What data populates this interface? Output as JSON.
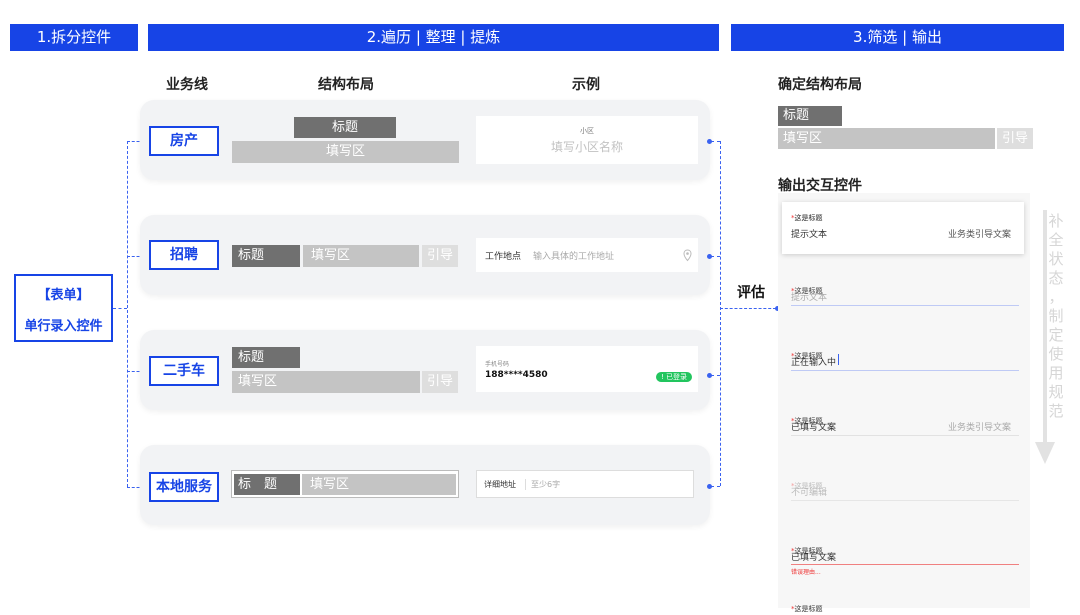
{
  "headers": {
    "step1": "1.拆分控件",
    "step2": "2.遍历 | 整理 | 提炼",
    "step3": "3.筛选 | 输出"
  },
  "columns": {
    "business": "业务线",
    "layout": "结构布局",
    "example": "示例"
  },
  "form": {
    "title": "【表单】",
    "subtitle": "单行录入控件"
  },
  "rows": {
    "house": {
      "name": "房产",
      "title": "标题",
      "fill": "填写区",
      "ex_label": "小区",
      "ex_placeholder": "填写小区名称"
    },
    "jobs": {
      "name": "招聘",
      "title": "标题",
      "fill": "填写区",
      "guide": "引导",
      "ex_label": "工作地点",
      "ex_placeholder": "输入具体的工作地址"
    },
    "car": {
      "name": "二手车",
      "title": "标题",
      "fill": "填写区",
      "guide": "引导",
      "ex_label": "手机号码",
      "ex_value": "188****4580",
      "ex_badge": "! 已登录"
    },
    "local": {
      "name": "本地服务",
      "title": "标　题",
      "fill": "填写区",
      "ex_label": "详细地址",
      "ex_placeholder": "至少6字"
    }
  },
  "evaluate": "评估",
  "right": {
    "confirm_title": "确定结构布局",
    "layout_title": "标题",
    "layout_fill": "填写区",
    "layout_guide": "引导",
    "output_title": "输出交互控件",
    "side_text": [
      "补",
      "全",
      "状",
      "态",
      "，",
      "制",
      "定",
      "使",
      "用",
      "规",
      "范"
    ],
    "states": [
      {
        "label": "这是标题",
        "value": "提示文本",
        "guide": "业务类引导文案"
      },
      {
        "label": "这是标题",
        "value": "提示文本"
      },
      {
        "label": "这是标题",
        "value": "正在输入中"
      },
      {
        "label": "这是标题",
        "value": "已填写文案",
        "guide": "业务类引导文案"
      },
      {
        "label": "这是标题",
        "value": "不可编辑"
      },
      {
        "label": "这是标题",
        "value": "已填写文案",
        "error": "错误理由..."
      },
      {
        "label": "这是标题"
      }
    ]
  },
  "colors": {
    "brand_blue": "#1744e6",
    "dark_gray": "#707070",
    "light_gray": "#c4c4c4",
    "badge_green": "#22c55e",
    "error_red": "#e33333"
  }
}
